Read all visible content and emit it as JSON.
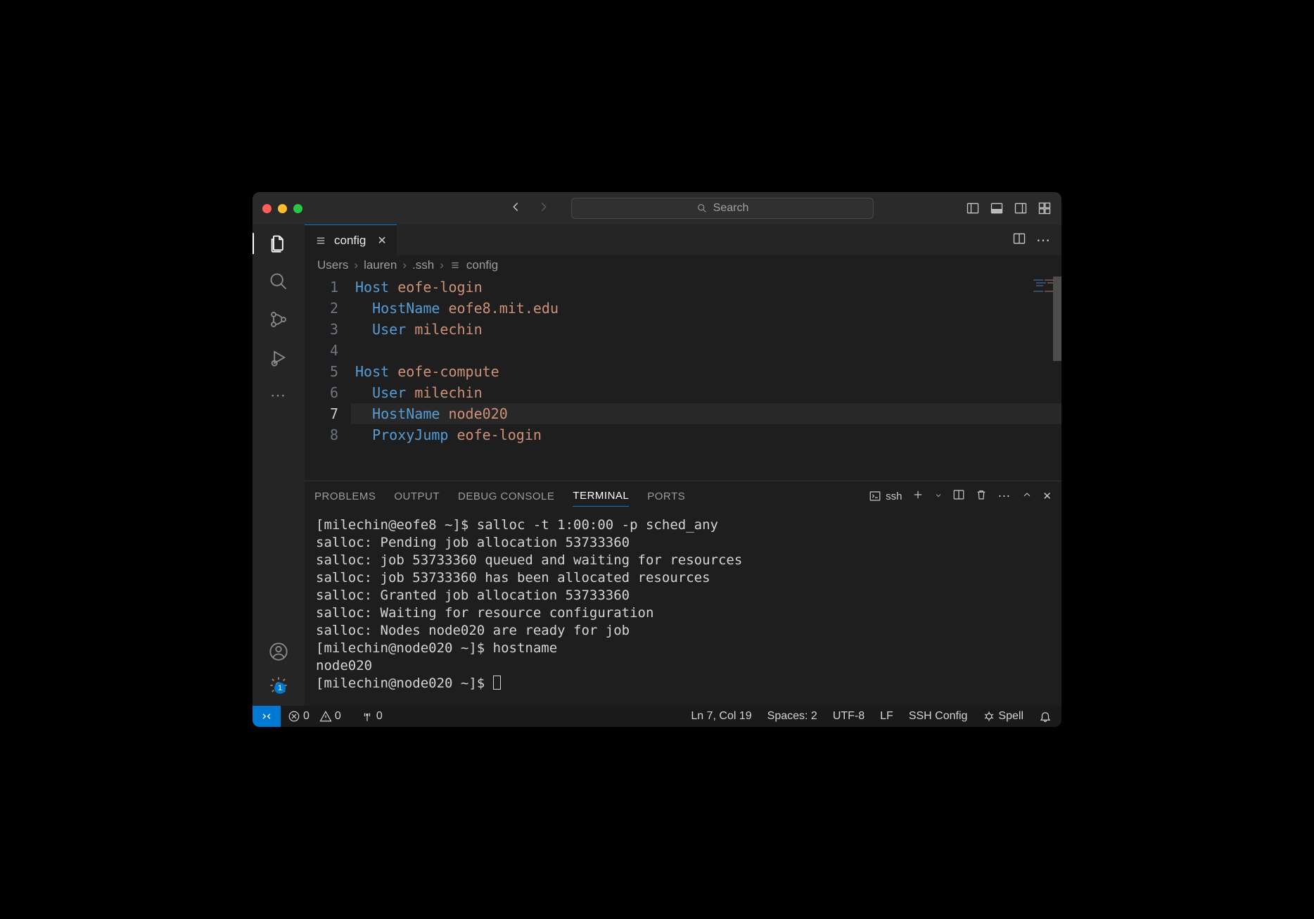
{
  "titlebar": {
    "search_placeholder": "Search"
  },
  "tab": {
    "filename": "config"
  },
  "breadcrumb": {
    "segments": [
      "Users",
      "lauren",
      ".ssh"
    ],
    "file": "config"
  },
  "editor": {
    "lines": [
      {
        "n": 1,
        "tokens": [
          [
            "kw",
            "Host"
          ],
          [
            "text",
            " "
          ],
          [
            "val",
            "eofe-login"
          ]
        ]
      },
      {
        "n": 2,
        "tokens": [
          [
            "text",
            "  "
          ],
          [
            "kw",
            "HostName"
          ],
          [
            "text",
            " "
          ],
          [
            "val",
            "eofe8.mit.edu"
          ]
        ]
      },
      {
        "n": 3,
        "tokens": [
          [
            "text",
            "  "
          ],
          [
            "kw",
            "User"
          ],
          [
            "text",
            " "
          ],
          [
            "val",
            "milechin"
          ]
        ]
      },
      {
        "n": 4,
        "tokens": [
          [
            "text",
            ""
          ]
        ]
      },
      {
        "n": 5,
        "tokens": [
          [
            "kw",
            "Host"
          ],
          [
            "text",
            " "
          ],
          [
            "val",
            "eofe-compute"
          ]
        ]
      },
      {
        "n": 6,
        "tokens": [
          [
            "text",
            "  "
          ],
          [
            "kw",
            "User"
          ],
          [
            "text",
            " "
          ],
          [
            "val",
            "milechin"
          ]
        ]
      },
      {
        "n": 7,
        "tokens": [
          [
            "text",
            "  "
          ],
          [
            "kw",
            "HostName"
          ],
          [
            "text",
            " "
          ],
          [
            "val",
            "node020"
          ]
        ],
        "current": true
      },
      {
        "n": 8,
        "tokens": [
          [
            "text",
            "  "
          ],
          [
            "kw",
            "ProxyJump"
          ],
          [
            "text",
            " "
          ],
          [
            "val",
            "eofe-login"
          ]
        ]
      }
    ]
  },
  "panel": {
    "tabs": {
      "problems": "PROBLEMS",
      "output": "OUTPUT",
      "debug_console": "DEBUG CONSOLE",
      "terminal": "TERMINAL",
      "ports": "PORTS"
    },
    "shell_label": "ssh",
    "terminal_lines": [
      "[milechin@eofe8 ~]$ salloc -t 1:00:00 -p sched_any",
      "salloc: Pending job allocation 53733360",
      "salloc: job 53733360 queued and waiting for resources",
      "salloc: job 53733360 has been allocated resources",
      "salloc: Granted job allocation 53733360",
      "salloc: Waiting for resource configuration",
      "salloc: Nodes node020 are ready for job",
      "[milechin@node020 ~]$ hostname",
      "node020",
      "[milechin@node020 ~]$ "
    ]
  },
  "statusbar": {
    "errors": "0",
    "warnings": "0",
    "ports": "0",
    "cursor": "Ln 7, Col 19",
    "indent": "Spaces: 2",
    "encoding": "UTF-8",
    "eol": "LF",
    "language": "SSH Config",
    "spell": "Spell"
  },
  "settings_badge": "1"
}
